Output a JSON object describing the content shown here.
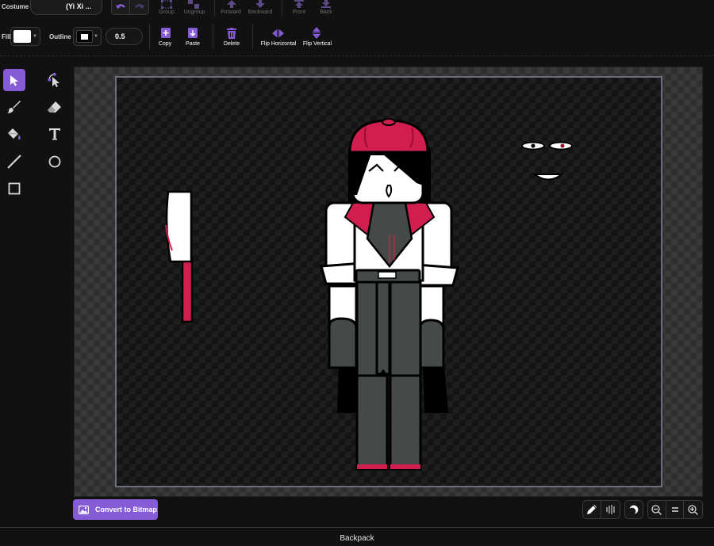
{
  "header": {
    "costume_label": "Costume",
    "costume_name": "(Yi Xi ...",
    "fill_label": "Fill",
    "outline_label": "Outline",
    "outline_width": "0.5",
    "fill_color": "#ffffff",
    "outline_color": "#ffffff"
  },
  "toolbar": {
    "group": "Group",
    "ungroup": "Ungroup",
    "forward": "Forward",
    "backward": "Backward",
    "front": "Front",
    "back": "Back",
    "copy": "Copy",
    "paste": "Paste",
    "delete": "Delete",
    "flip_horizontal": "Flip Horizontal",
    "flip_vertical": "Flip Vertical"
  },
  "tools": [
    {
      "icon": "select-arrow-icon",
      "active": true
    },
    {
      "icon": "reshape-icon",
      "active": false
    },
    {
      "icon": "brush-icon",
      "active": false
    },
    {
      "icon": "eraser-icon",
      "active": false
    },
    {
      "icon": "fill-bucket-icon",
      "active": false
    },
    {
      "icon": "text-icon",
      "active": false
    },
    {
      "icon": "line-icon",
      "active": false
    },
    {
      "icon": "circle-icon",
      "active": false
    },
    {
      "icon": "rectangle-icon",
      "active": false
    }
  ],
  "bottom": {
    "convert_button": "Convert to Bitmap",
    "backpack": "Backpack"
  },
  "colors": {
    "accent": "#855cd6",
    "crimson": "#d21e4f",
    "background": "#111111"
  }
}
